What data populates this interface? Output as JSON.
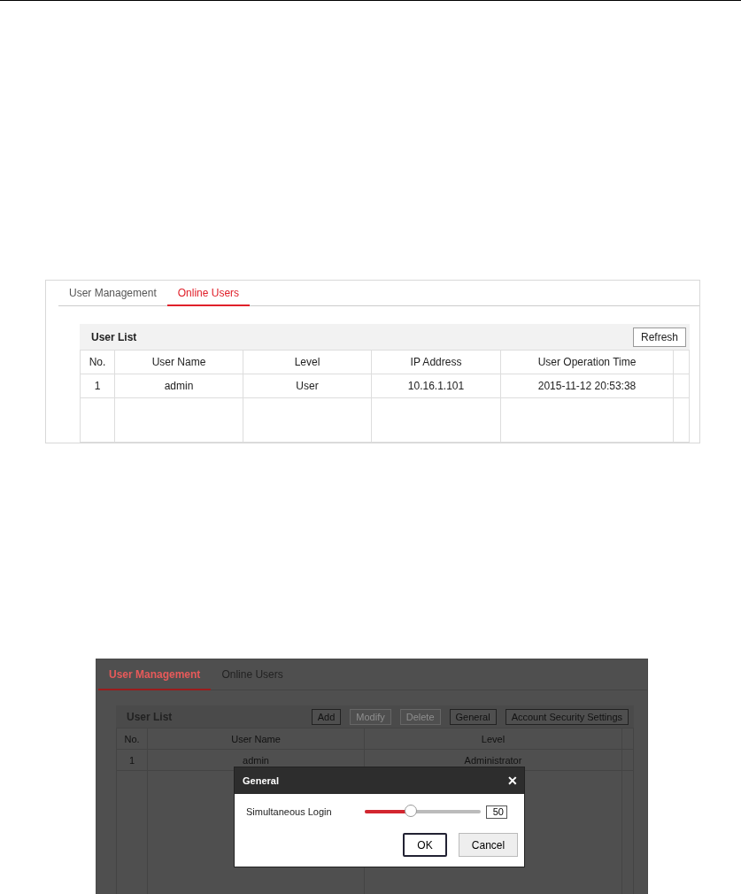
{
  "screens": [
    {
      "tabs": [
        {
          "label": "User Management",
          "selected": false
        },
        {
          "label": "Online Users",
          "selected": true
        }
      ],
      "user_list": {
        "title": "User List",
        "buttons": [
          {
            "label": "Refresh",
            "disabled": false
          }
        ],
        "columns": [
          "No.",
          "User Name",
          "Level",
          "IP Address",
          "User Operation Time"
        ],
        "rows": [
          [
            "1",
            "admin",
            "User",
            "10.16.1.101",
            "2015-11-12 20:53:38"
          ]
        ]
      }
    },
    {
      "tabs": [
        {
          "label": "User Management",
          "selected": true
        },
        {
          "label": "Online Users",
          "selected": false
        }
      ],
      "user_list": {
        "title": "User List",
        "buttons": [
          {
            "label": "Add",
            "disabled": false
          },
          {
            "label": "Modify",
            "disabled": true
          },
          {
            "label": "Delete",
            "disabled": true
          },
          {
            "label": "General",
            "disabled": false
          },
          {
            "label": "Account Security Settings",
            "disabled": false
          }
        ],
        "columns": [
          "No.",
          "User Name",
          "Level"
        ],
        "rows": [
          [
            "1",
            "admin",
            "Administrator"
          ]
        ]
      },
      "dialog": {
        "title": "General",
        "close": "✕",
        "field_label": "Simultaneous Login",
        "level": 0.4,
        "value": "50",
        "buttons": [
          {
            "label": "OK",
            "selected": true
          },
          {
            "label": "Cancel",
            "selected": false
          }
        ]
      }
    }
  ]
}
